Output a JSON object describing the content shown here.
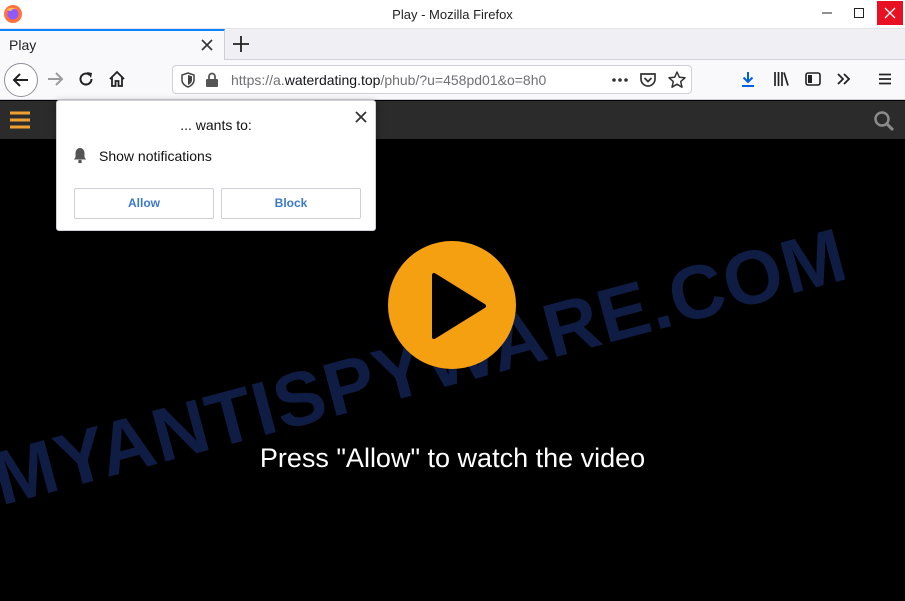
{
  "window": {
    "title": "Play - Mozilla Firefox"
  },
  "tabs": [
    {
      "label": "Play",
      "active": true
    }
  ],
  "urlbar": {
    "prefix": "https://a.",
    "domain": "waterdating.top",
    "path": "/phub/?u=458pd01&o=8h0"
  },
  "icons": {
    "window": [
      "firefox-logo",
      "minimize-icon",
      "maximize-icon",
      "close-icon"
    ],
    "nav": [
      "back-arrow-icon",
      "forward-arrow-icon",
      "reload-icon",
      "home-icon",
      "tracking-shield-icon",
      "padlock-icon",
      "page-actions-ellipsis-icon",
      "pocket-icon",
      "bookmark-star-icon",
      "download-icon",
      "library-icon",
      "sidebar-icon",
      "overflow-chevrons-icon",
      "hamburger-menu-icon"
    ],
    "site": [
      "hamburger-menu-icon",
      "search-icon",
      "play-icon"
    ],
    "popup": [
      "close-icon",
      "bell-icon"
    ]
  },
  "page": {
    "cta": "Press \"Allow\" to watch the video",
    "watermark": "MYANTISPYWARE.COM"
  },
  "permission_popup": {
    "title": "... wants to:",
    "permission": "Show notifications",
    "allow_label": "Allow",
    "block_label": "Block"
  },
  "colors": {
    "accent_blue": "#0a84ff",
    "close_red": "#e81123",
    "play_orange": "#f5a011",
    "menu_orange": "#f0a030",
    "button_text_blue": "#3c78c8",
    "download_blue": "#0060df",
    "watermark_navy": "#0f1d44"
  }
}
